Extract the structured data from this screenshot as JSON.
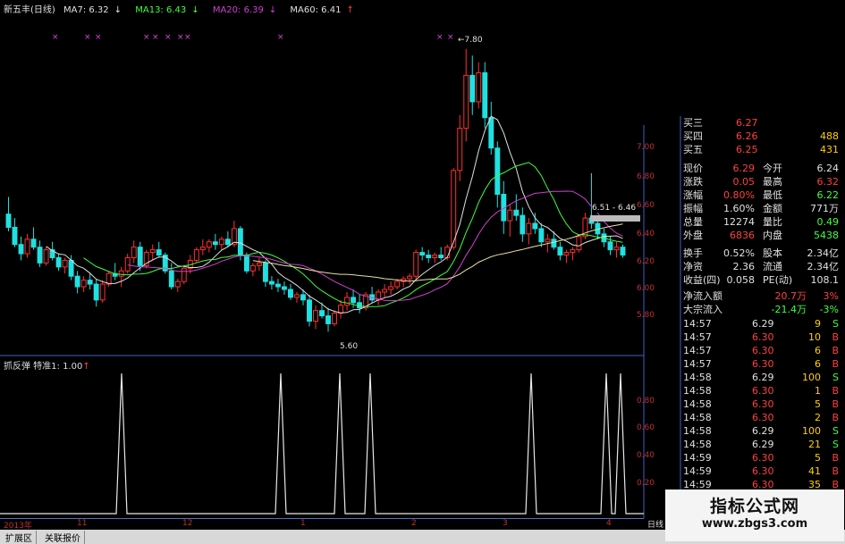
{
  "header": {
    "title": "新五丰(日线)",
    "ma": [
      {
        "label": "MA7: 6.32",
        "arrow": "↓",
        "color": "#e0e0e0"
      },
      {
        "label": "MA13: 6.43",
        "arrow": "↓",
        "color": "#40ff40"
      },
      {
        "label": "MA20: 6.39",
        "arrow": "↓",
        "color": "#d040d0"
      },
      {
        "label": "MA60: 6.41",
        "arrow": "↑",
        "color": "#e0e0e0"
      }
    ]
  },
  "indicator": {
    "label": "抓反弹  特准1: 1.00",
    "arrow": "↑"
  },
  "price_axis": [
    "7.00",
    "6.80",
    "6.60",
    "6.40",
    "6.20",
    "6.00",
    "5.80"
  ],
  "ind_axis": [
    "0.80",
    "0.60",
    "0.40",
    "0.20"
  ],
  "annotations": {
    "high": "7.80",
    "low": "5.60",
    "range": "6.51 - 6.46"
  },
  "bottom_axis": [
    "2013年",
    "11",
    "12",
    "1",
    "2",
    "3",
    "4"
  ],
  "corner_label": "日线",
  "tabs": [
    "扩展区",
    "关联报价"
  ],
  "quotes": [
    {
      "l": "买三",
      "v": "6.27",
      "r": "",
      "lc": "red",
      "vc": "red",
      "rc": "yel"
    },
    {
      "l": "买四",
      "v": "6.26",
      "r": "488",
      "lc": "red",
      "vc": "red",
      "rc": "yel"
    },
    {
      "l": "买五",
      "v": "6.25",
      "r": "431",
      "lc": "red",
      "vc": "red",
      "rc": "yel"
    }
  ],
  "stats": [
    {
      "a": "现价",
      "b": "6.29",
      "c": "今开",
      "d": "6.24",
      "bc": "red",
      "dc": "wht"
    },
    {
      "a": "涨跌",
      "b": "0.05",
      "c": "最高",
      "d": "6.32",
      "bc": "red",
      "dc": "red"
    },
    {
      "a": "涨幅",
      "b": "0.80%",
      "c": "最低",
      "d": "6.22",
      "bc": "red",
      "dc": "grn"
    },
    {
      "a": "振幅",
      "b": "1.60%",
      "c": "金额",
      "d": "771万",
      "bc": "wht",
      "dc": "wht"
    },
    {
      "a": "总量",
      "b": "12274",
      "c": "量比",
      "d": "0.49",
      "bc": "wht",
      "dc": "grn"
    },
    {
      "a": "外盘",
      "b": "6836",
      "c": "内盘",
      "d": "5438",
      "bc": "red",
      "dc": "grn"
    }
  ],
  "stats2": [
    {
      "a": "换手",
      "b": "0.52%",
      "c": "股本",
      "d": "2.34亿"
    },
    {
      "a": "净资",
      "b": "2.36",
      "c": "流通",
      "d": "2.34亿"
    },
    {
      "a": "收益(四)",
      "b": "0.058",
      "c": "PE(动)",
      "d": "108.1"
    }
  ],
  "flows": [
    {
      "a": "净流入额",
      "b": "20.7万",
      "c": "3%",
      "bc": "red",
      "cc": "red"
    },
    {
      "a": "大宗流入",
      "b": "-21.4万",
      "c": "-3%",
      "bc": "grn",
      "cc": "grn"
    }
  ],
  "ticks": [
    {
      "t": "14:57",
      "p": "6.29",
      "v": "9",
      "s": "S"
    },
    {
      "t": "14:57",
      "p": "6.30",
      "v": "10",
      "s": "B"
    },
    {
      "t": "14:57",
      "p": "6.30",
      "v": "6",
      "s": "B"
    },
    {
      "t": "14:57",
      "p": "6.30",
      "v": "6",
      "s": "B"
    },
    {
      "t": "14:58",
      "p": "6.29",
      "v": "100",
      "s": "S"
    },
    {
      "t": "14:58",
      "p": "6.30",
      "v": "1",
      "s": "B"
    },
    {
      "t": "14:58",
      "p": "6.30",
      "v": "5",
      "s": "B"
    },
    {
      "t": "14:58",
      "p": "6.30",
      "v": "2",
      "s": "B"
    },
    {
      "t": "14:58",
      "p": "6.29",
      "v": "100",
      "s": "S"
    },
    {
      "t": "14:58",
      "p": "6.29",
      "v": "21",
      "s": "S"
    },
    {
      "t": "14:59",
      "p": "6.30",
      "v": "5",
      "s": "B"
    },
    {
      "t": "14:59",
      "p": "6.30",
      "v": "41",
      "s": "B"
    },
    {
      "t": "14:59",
      "p": "6.30",
      "v": "35",
      "s": "B"
    },
    {
      "t": "14:59",
      "p": "6.30",
      "v": "40",
      "s": "B"
    },
    {
      "t": "14:59",
      "p": "6.29",
      "v": "10",
      "s": "S"
    },
    {
      "t": "14:59",
      "p": "6.29",
      "v": "5",
      "s": "S"
    }
  ],
  "watermark": {
    "line1": "指标公式网",
    "line2": "www.zbgs3.com"
  },
  "chart_data": {
    "type": "candlestick",
    "ylim": [
      5.6,
      7.1
    ],
    "candles": [
      [
        6.55,
        6.68,
        6.42,
        6.45
      ],
      [
        6.45,
        6.52,
        6.3,
        6.32
      ],
      [
        6.32,
        6.38,
        6.2,
        6.25
      ],
      [
        6.25,
        6.4,
        6.22,
        6.36
      ],
      [
        6.36,
        6.45,
        6.28,
        6.3
      ],
      [
        6.3,
        6.35,
        6.15,
        6.18
      ],
      [
        6.18,
        6.3,
        6.16,
        6.28
      ],
      [
        6.28,
        6.34,
        6.2,
        6.22
      ],
      [
        6.22,
        6.25,
        6.12,
        6.15
      ],
      [
        6.15,
        6.22,
        6.1,
        6.2
      ],
      [
        6.2,
        6.24,
        6.05,
        6.08
      ],
      [
        6.08,
        6.12,
        5.95,
        6.0
      ],
      [
        6.0,
        6.08,
        5.96,
        6.05
      ],
      [
        6.05,
        6.1,
        5.98,
        6.02
      ],
      [
        6.02,
        6.06,
        5.85,
        5.9
      ],
      [
        5.9,
        6.05,
        5.88,
        6.02
      ],
      [
        6.02,
        6.12,
        6.0,
        6.1
      ],
      [
        6.1,
        6.18,
        6.05,
        6.08
      ],
      [
        6.08,
        6.15,
        6.0,
        6.12
      ],
      [
        6.12,
        6.25,
        6.1,
        6.22
      ],
      [
        6.22,
        6.35,
        6.18,
        6.3
      ],
      [
        6.3,
        6.34,
        6.12,
        6.16
      ],
      [
        6.16,
        6.28,
        6.14,
        6.26
      ],
      [
        6.26,
        6.32,
        6.2,
        6.28
      ],
      [
        6.28,
        6.34,
        6.22,
        6.24
      ],
      [
        6.24,
        6.26,
        6.1,
        6.12
      ],
      [
        6.12,
        6.18,
        5.98,
        6.0
      ],
      [
        6.0,
        6.06,
        5.96,
        6.04
      ],
      [
        6.04,
        6.15,
        6.02,
        6.14
      ],
      [
        6.14,
        6.24,
        6.1,
        6.2
      ],
      [
        6.2,
        6.3,
        6.18,
        6.28
      ],
      [
        6.28,
        6.36,
        6.24,
        6.3
      ],
      [
        6.3,
        6.36,
        6.26,
        6.34
      ],
      [
        6.34,
        6.4,
        6.28,
        6.32
      ],
      [
        6.32,
        6.38,
        6.28,
        6.36
      ],
      [
        6.36,
        6.42,
        6.3,
        6.32
      ],
      [
        6.32,
        6.5,
        6.3,
        6.44
      ],
      [
        6.44,
        6.46,
        6.2,
        6.24
      ],
      [
        6.24,
        6.26,
        6.1,
        6.12
      ],
      [
        6.12,
        6.18,
        6.08,
        6.16
      ],
      [
        6.16,
        6.22,
        6.12,
        6.18
      ],
      [
        6.18,
        6.2,
        6.0,
        6.04
      ],
      [
        6.04,
        6.08,
        5.98,
        6.02
      ],
      [
        6.02,
        6.06,
        5.96,
        6.0
      ],
      [
        6.0,
        6.04,
        5.94,
        5.98
      ],
      [
        5.98,
        6.02,
        5.9,
        5.92
      ],
      [
        5.92,
        5.96,
        5.88,
        5.94
      ],
      [
        5.94,
        5.98,
        5.86,
        5.9
      ],
      [
        5.9,
        5.94,
        5.7,
        5.74
      ],
      [
        5.74,
        5.86,
        5.68,
        5.82
      ],
      [
        5.82,
        5.88,
        5.76,
        5.78
      ],
      [
        5.78,
        5.84,
        5.66,
        5.72
      ],
      [
        5.72,
        5.82,
        5.7,
        5.8
      ],
      [
        5.8,
        5.9,
        5.76,
        5.86
      ],
      [
        5.86,
        5.96,
        5.82,
        5.92
      ],
      [
        5.92,
        5.98,
        5.84,
        5.88
      ],
      [
        5.88,
        5.94,
        5.8,
        5.84
      ],
      [
        5.84,
        5.96,
        5.82,
        5.94
      ],
      [
        5.94,
        6.0,
        5.88,
        5.9
      ],
      [
        5.9,
        5.98,
        5.86,
        5.96
      ],
      [
        5.96,
        6.02,
        5.92,
        5.98
      ],
      [
        5.98,
        6.04,
        5.94,
        6.0
      ],
      [
        6.0,
        6.06,
        5.98,
        6.04
      ],
      [
        6.04,
        6.08,
        6.0,
        6.06
      ],
      [
        6.06,
        6.1,
        6.02,
        6.08
      ],
      [
        6.08,
        6.28,
        6.06,
        6.26
      ],
      [
        6.26,
        6.3,
        6.2,
        6.24
      ],
      [
        6.24,
        6.28,
        6.18,
        6.22
      ],
      [
        6.22,
        6.26,
        6.18,
        6.24
      ],
      [
        6.24,
        6.3,
        6.2,
        6.22
      ],
      [
        6.22,
        6.32,
        6.2,
        6.3
      ],
      [
        6.3,
        6.9,
        6.28,
        6.88
      ],
      [
        6.88,
        7.3,
        6.8,
        7.2
      ],
      [
        7.2,
        7.8,
        7.1,
        7.6
      ],
      [
        7.6,
        7.75,
        7.3,
        7.4
      ],
      [
        7.4,
        7.7,
        7.35,
        7.62
      ],
      [
        7.62,
        7.7,
        7.2,
        7.28
      ],
      [
        7.28,
        7.4,
        7.0,
        7.05
      ],
      [
        7.05,
        7.1,
        6.6,
        6.7
      ],
      [
        6.7,
        6.8,
        6.4,
        6.5
      ],
      [
        6.5,
        6.62,
        6.38,
        6.58
      ],
      [
        6.58,
        6.7,
        6.5,
        6.54
      ],
      [
        6.54,
        6.6,
        6.34,
        6.4
      ],
      [
        6.4,
        6.52,
        6.32,
        6.48
      ],
      [
        6.48,
        6.56,
        6.4,
        6.44
      ],
      [
        6.44,
        6.48,
        6.3,
        6.34
      ],
      [
        6.34,
        6.4,
        6.26,
        6.36
      ],
      [
        6.36,
        6.42,
        6.28,
        6.3
      ],
      [
        6.3,
        6.34,
        6.2,
        6.24
      ],
      [
        6.24,
        6.28,
        6.18,
        6.26
      ],
      [
        6.26,
        6.3,
        6.2,
        6.28
      ],
      [
        6.28,
        6.4,
        6.26,
        6.38
      ],
      [
        6.38,
        6.56,
        6.36,
        6.52
      ],
      [
        6.52,
        6.86,
        6.44,
        6.48
      ],
      [
        6.48,
        6.52,
        6.36,
        6.4
      ],
      [
        6.4,
        6.44,
        6.3,
        6.34
      ],
      [
        6.34,
        6.38,
        6.24,
        6.28
      ],
      [
        6.28,
        6.34,
        6.22,
        6.3
      ],
      [
        6.3,
        6.32,
        6.22,
        6.24
      ]
    ],
    "signal_x": [
      136,
      314,
      380,
      414,
      594,
      678,
      694
    ]
  }
}
